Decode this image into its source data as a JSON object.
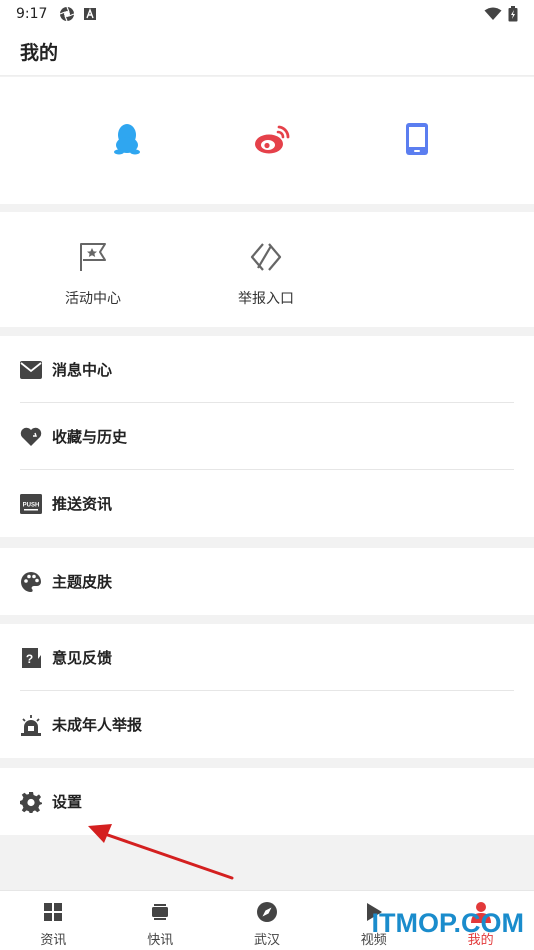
{
  "status_bar": {
    "time": "9:17"
  },
  "header": {
    "title": "我的"
  },
  "login_icons": [
    "qq-icon",
    "weibo-icon",
    "phone-icon"
  ],
  "quick_actions": [
    {
      "label": "活动中心",
      "icon": "flag-star-icon"
    },
    {
      "label": "举报入口",
      "icon": "report-icon"
    }
  ],
  "menu_groups": [
    {
      "items": [
        {
          "label": "消息中心",
          "icon": "mail-icon"
        },
        {
          "label": "收藏与历史",
          "icon": "heart-icon"
        },
        {
          "label": "推送资讯",
          "icon": "push-icon",
          "icon_text": "PUSH"
        }
      ]
    },
    {
      "items": [
        {
          "label": "主题皮肤",
          "icon": "palette-icon"
        }
      ]
    },
    {
      "items": [
        {
          "label": "意见反馈",
          "icon": "feedback-icon"
        },
        {
          "label": "未成年人举报",
          "icon": "alarm-icon"
        }
      ]
    },
    {
      "items": [
        {
          "label": "设置",
          "icon": "gear-icon"
        }
      ]
    }
  ],
  "bottom_nav": [
    {
      "label": "资讯",
      "icon": "grid-icon"
    },
    {
      "label": "快讯",
      "icon": "tv-icon"
    },
    {
      "label": "武汉",
      "icon": "compass-icon"
    },
    {
      "label": "视频",
      "icon": "play-icon"
    },
    {
      "label": "我的",
      "icon": "user-icon",
      "active": true
    }
  ],
  "watermark": "ITMOP.COM",
  "colors": {
    "accent_red": "#e2393a",
    "qq_blue": "#2fa6f0",
    "weibo_red": "#e5414a",
    "phone_blue": "#5b7ef0",
    "watermark_blue": "#1a8ccc"
  }
}
